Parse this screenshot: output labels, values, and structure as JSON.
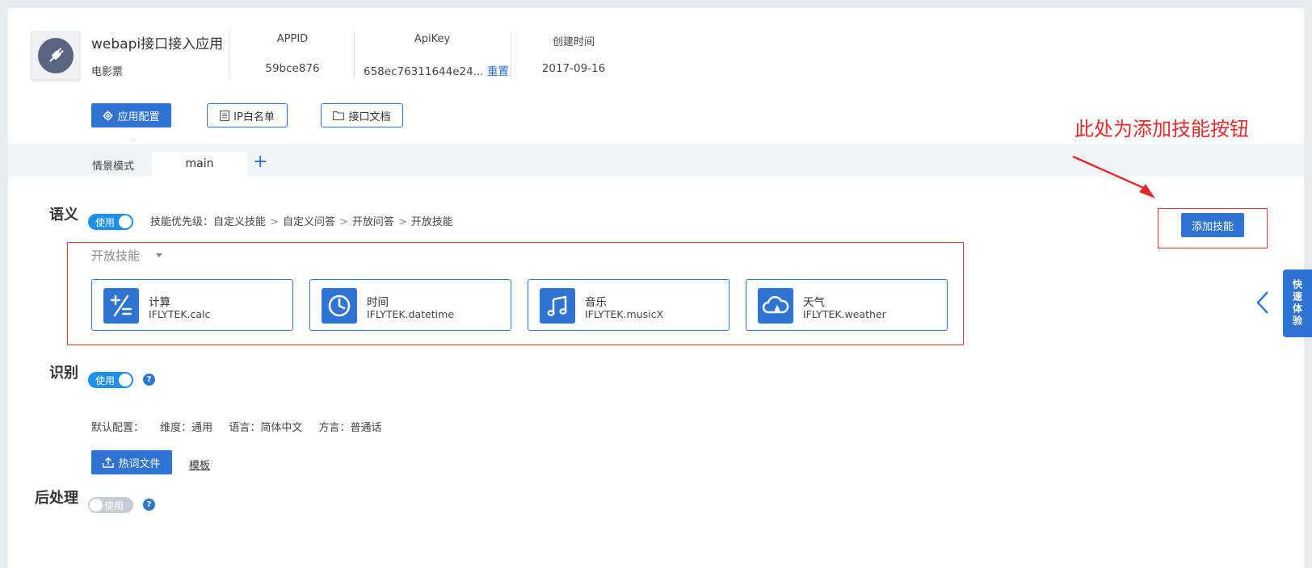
{
  "app": {
    "name": "webapi接口接入应用",
    "subtitle": "电影票",
    "appid_label": "APPID",
    "appid_value": "59bce876",
    "apikey_label": "ApiKey",
    "apikey_value": "658ec76311644e24...",
    "reset_label": "重置",
    "created_label": "创建时间",
    "created_value": "2017-09-16"
  },
  "toolbar": {
    "config_label": "应用配置",
    "ip_whitelist_label": "IP白名单",
    "api_docs_label": "接口文档"
  },
  "tabs": {
    "scene_label": "情景模式",
    "items": [
      {
        "label": "main",
        "active": true
      }
    ],
    "add_label": "+"
  },
  "semantic": {
    "title": "语义",
    "toggle_label": "使用",
    "priority_prefix": "技能优先级：",
    "priority_items": [
      "自定义技能",
      "自定义问答",
      "开放问答",
      "开放技能"
    ],
    "priority_sep": ">",
    "add_skill_label": "添加技能",
    "dropdown_label": "开放技能",
    "skills": [
      {
        "name": "计算",
        "code": "IFLYTEK.calc",
        "icon": "calc-icon"
      },
      {
        "name": "时间",
        "code": "IFLYTEK.datetime",
        "icon": "clock-icon"
      },
      {
        "name": "音乐",
        "code": "IFLYTEK.musicX",
        "icon": "music-note-icon"
      },
      {
        "name": "天气",
        "code": "IFLYTEK.weather",
        "icon": "cloud-icon"
      }
    ]
  },
  "recognition": {
    "title": "识别",
    "toggle_label": "使用",
    "help": "?",
    "default_label": "默认配置：",
    "dimension": "维度：通用",
    "language": "语言：简体中文",
    "dialect": "方言：普通话",
    "hotword_label": "热词文件",
    "template_label": "模板"
  },
  "postprocess": {
    "title": "后处理",
    "toggle_label": "使用",
    "help": "?"
  },
  "annotation": {
    "text": "此处为添加技能按钮",
    "color": "#e02c2c"
  },
  "quick_trial": {
    "label": "快速体验"
  },
  "colors": {
    "accent": "#2f74d0",
    "toggle_on": "#1e90ec",
    "toggle_off": "#c7ccd3"
  }
}
